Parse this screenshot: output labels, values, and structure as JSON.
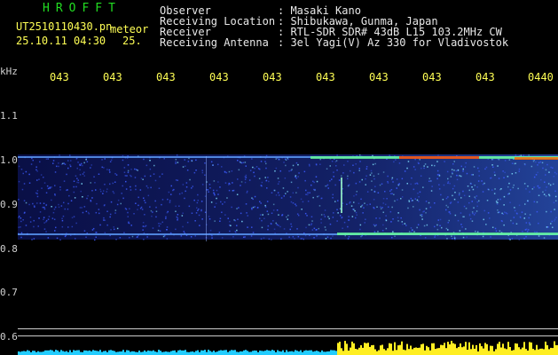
{
  "header": {
    "brand": "HROFFT",
    "filename": "UT2510110430.pn",
    "meteor_label": "meteor",
    "datetime": "25.10.11 04:30",
    "meteor_count": "25.",
    "fields": [
      {
        "label": "Observer",
        "value": ": Masaki Kano"
      },
      {
        "label": "Receiving Location",
        "value": ": Shibukawa, Gunma, Japan"
      },
      {
        "label": "Receiver",
        "value": ": RTL-SDR SDR# 43dB L15 103.2MHz CW"
      },
      {
        "label": "Receiving Antenna",
        "value": ": 3el Yagi(V) Az 330 for Vladivostok"
      }
    ]
  },
  "axis": {
    "unit": "kHz",
    "y_labels": [
      "1.1",
      "1.0",
      "0.9",
      "0.8",
      "0.7",
      "0.6"
    ],
    "time_ticks": [
      "043",
      "043",
      "043",
      "043",
      "043",
      "043",
      "043",
      "043",
      "043",
      "0440"
    ]
  },
  "colors": {
    "background": "#000000",
    "noise": "#1c2cc8",
    "text_header": "#ffff55",
    "brand": "#22dd22",
    "signal_hot": "#ff3300",
    "signal_band": "#66ff99",
    "footer_left": "#22ccff",
    "footer_right": "#ffee22"
  }
}
